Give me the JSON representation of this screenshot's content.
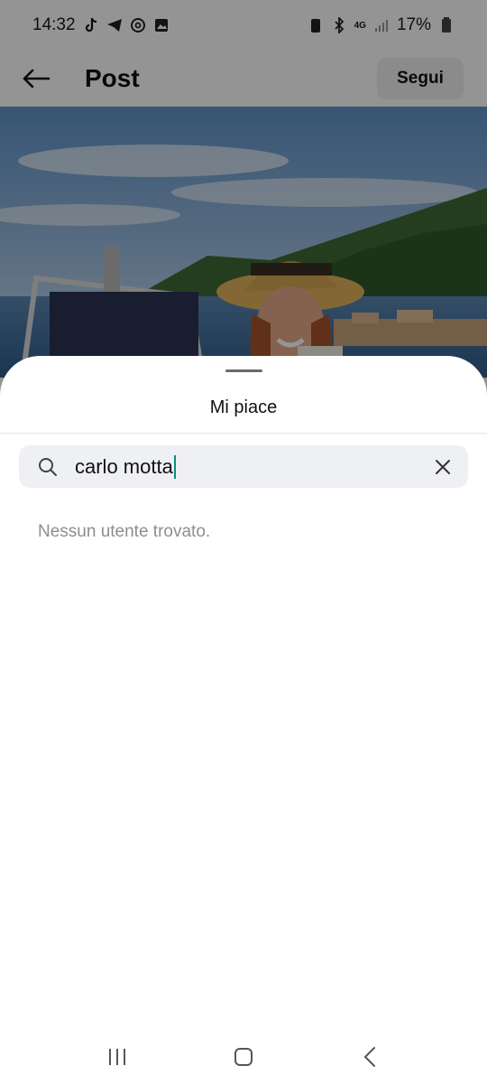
{
  "status_bar": {
    "time": "14:32",
    "battery_percent": "17%",
    "network": "4G",
    "left_icons": [
      "tiktok-icon",
      "telegram-icon",
      "threads-icon",
      "gallery-icon"
    ],
    "right_icons": [
      "battery-saver-icon",
      "bluetooth-icon",
      "signal-icon",
      "battery-icon"
    ]
  },
  "header": {
    "title": "Post",
    "follow_label": "Segui"
  },
  "likes_sheet": {
    "title": "Mi piace",
    "search": {
      "value": "carlo motta"
    },
    "empty_message": "Nessun utente trovato."
  },
  "colors": {
    "accent_caret": "#0e8a7d",
    "search_bg": "#eff0f3",
    "muted_text": "#8e8e8e"
  }
}
